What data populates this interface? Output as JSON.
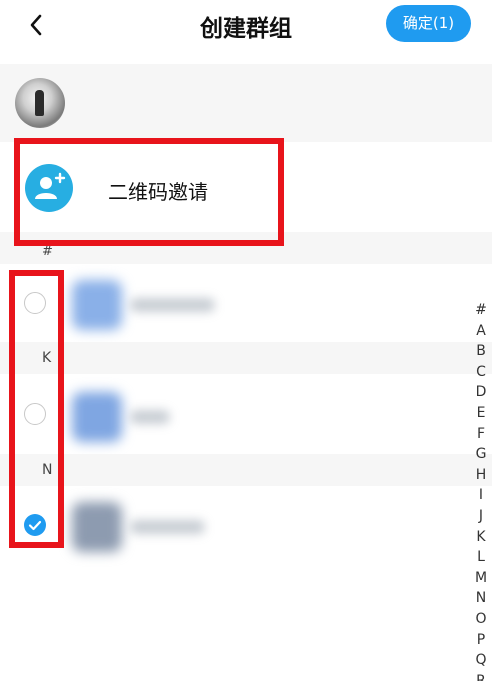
{
  "header": {
    "back_icon": "chevron-left-icon",
    "title": "创建群组",
    "confirm_label": "确定(1)",
    "confirm_color": "#1f9bf0"
  },
  "selected": {
    "avatar_icon": "photo-avatar"
  },
  "qr_invite": {
    "icon": "add-user-icon",
    "icon_color": "#27aee2",
    "label": "二维码邀请"
  },
  "sections": [
    {
      "letter": "#",
      "contacts": [
        {
          "checked": false
        }
      ]
    },
    {
      "letter": "K",
      "contacts": [
        {
          "checked": false
        }
      ]
    },
    {
      "letter": "N",
      "contacts": [
        {
          "checked": true
        }
      ]
    }
  ],
  "index_letters": [
    "#",
    "A",
    "B",
    "C",
    "D",
    "E",
    "F",
    "G",
    "H",
    "I",
    "J",
    "K",
    "L",
    "M",
    "N",
    "O",
    "P",
    "Q",
    "R"
  ],
  "highlight_color": "#e8141b"
}
